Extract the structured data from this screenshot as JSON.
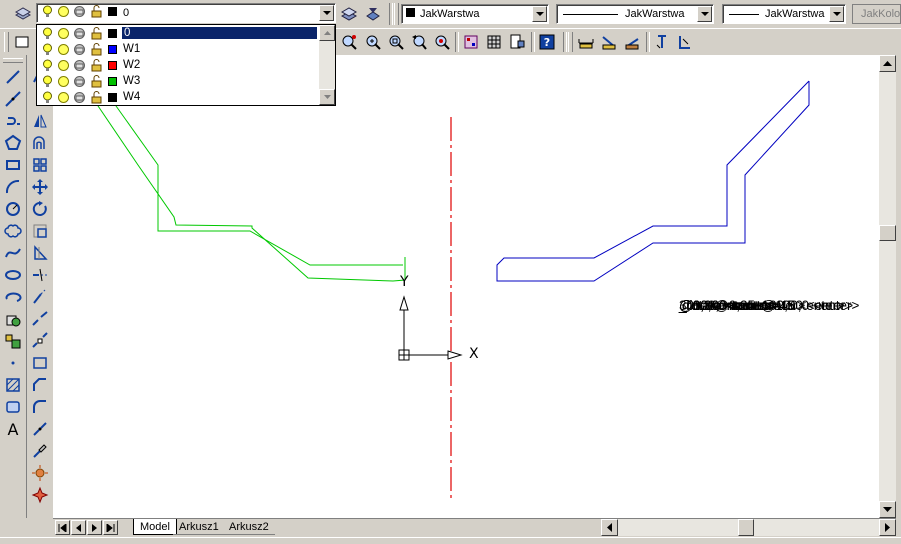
{
  "layers_toolbar": {
    "current_layer": "0",
    "color_combo": "JakWarstwa",
    "linetype_combo": "JakWarstwa",
    "lineweight_combo": "JakWarstwa",
    "plotstyle_combo": "JakKolor"
  },
  "layer_dropdown": {
    "items": [
      {
        "label": "0",
        "color": "#000000",
        "selected": true
      },
      {
        "label": "W1",
        "color": "#0000ff",
        "selected": false
      },
      {
        "label": "W2",
        "color": "#ff0000",
        "selected": false
      },
      {
        "label": "W3",
        "color": "#00c000",
        "selected": false
      },
      {
        "label": "W4",
        "color": "#000000",
        "selected": false
      }
    ]
  },
  "ucs": {
    "x_label": "X",
    "y_label": "Y"
  },
  "command_notes": [
    "_line <enter> 100,80 <enter>",
    "@100,0 <enter>",
    "@80,0   <enter>",
    "_rotate   <enter>",
    "30    <enter>",
    "_line <enter> @100,0 <enter>",
    "@0,80  <enter>",
    "@0,100  <enter>",
    "_rotate <enter> -45 <enter>",
    "_line  @0,25 <enter>"
  ],
  "layout_tabs": {
    "tabs": [
      {
        "label": "Model",
        "active": true
      },
      {
        "label": "Arkusz1",
        "active": false
      },
      {
        "label": "Arkusz2",
        "active": false
      }
    ]
  },
  "colors": {
    "green_polyline": "#00c800",
    "blue_polyline": "#0000c0",
    "center_line": "#e00000"
  }
}
